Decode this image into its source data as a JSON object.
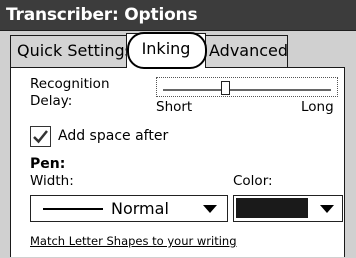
{
  "window": {
    "title": "Transcriber: Options"
  },
  "tabs": [
    {
      "label": "Quick Settings"
    },
    {
      "label": "Inking",
      "selected": true
    },
    {
      "label": "Advanced"
    }
  ],
  "recognition": {
    "label": "Recognition Delay:",
    "min_label": "Short",
    "max_label": "Long",
    "level_percent": 37
  },
  "add_space": {
    "label": "Add space after",
    "checked": true
  },
  "pen": {
    "heading": "Pen:",
    "width_label": "Width:",
    "width_value": "Normal",
    "color_label": "Color:",
    "color_value": "#1a1a1a"
  },
  "link": {
    "text": "Match Letter Shapes to your writing"
  }
}
